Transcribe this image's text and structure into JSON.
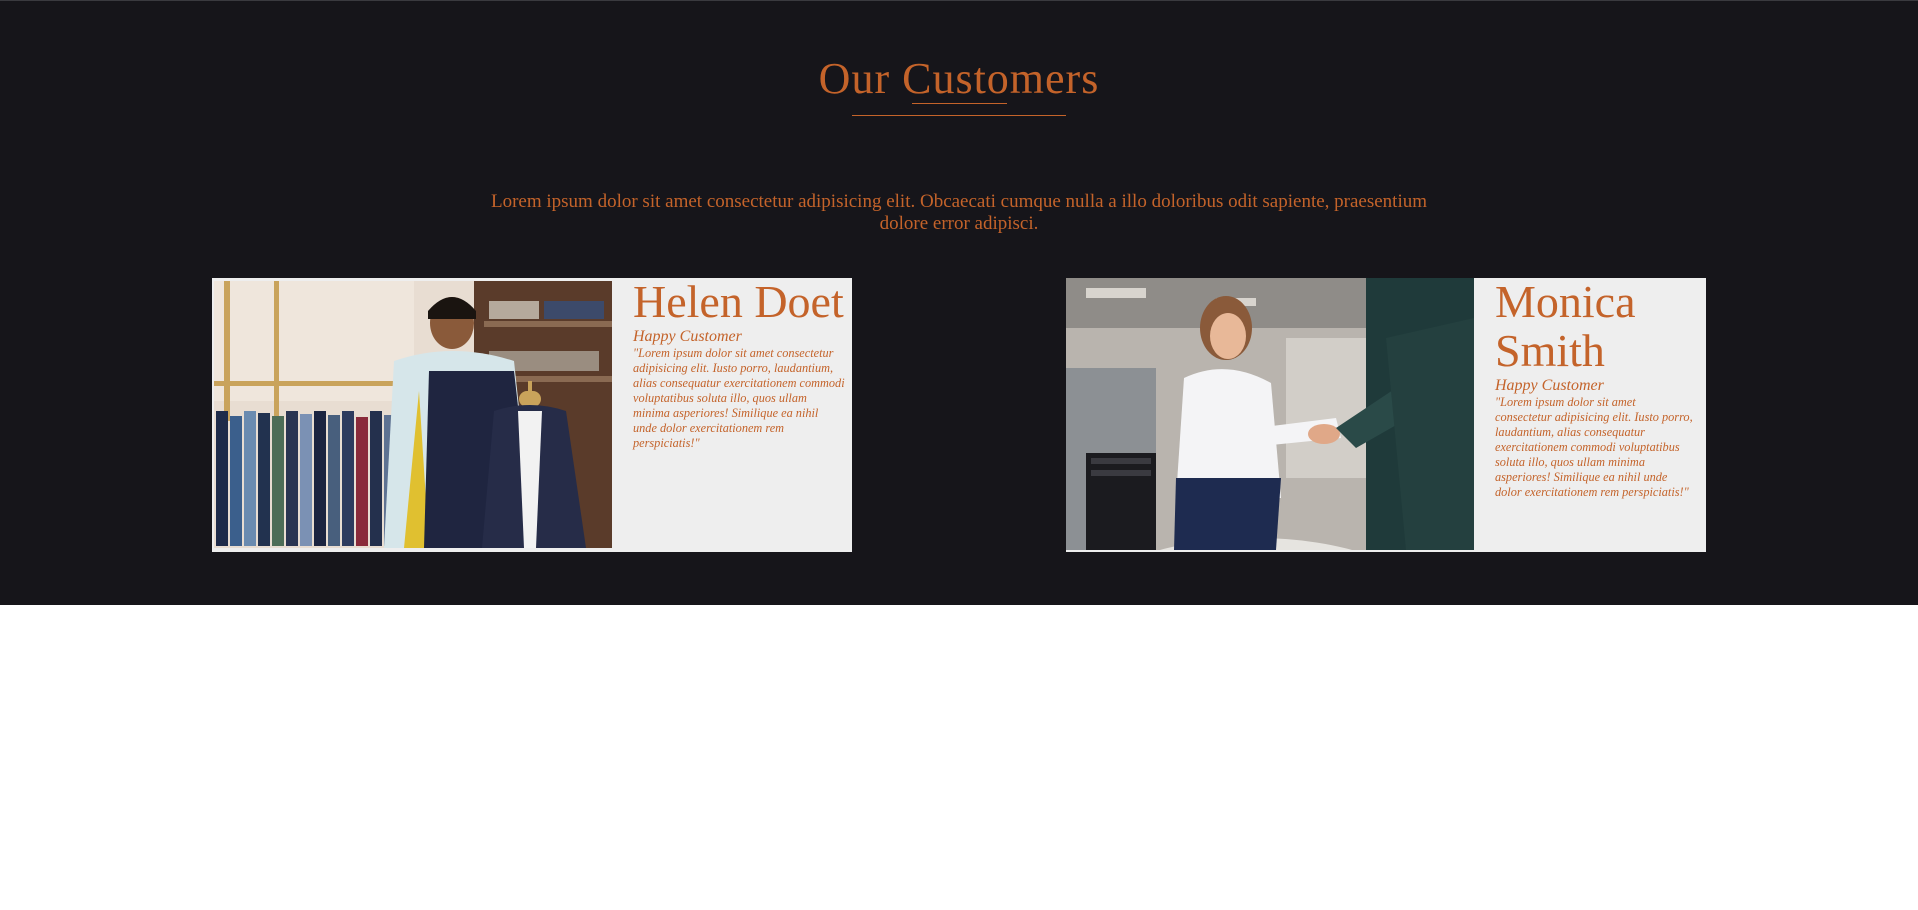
{
  "section": {
    "title": "Our Customers",
    "intro": "Lorem ipsum dolor sit amet consectetur adipisicing elit. Obcaecati cumque nulla a illo doloribus odit sapiente, praesentium dolore error adipisci."
  },
  "customers": [
    {
      "name": "Helen Doet",
      "role": "Happy Customer",
      "quote": "\"Lorem ipsum dolor sit amet consectetur adipisicing elit. Iusto porro, laudantium, alias consequatur exercitationem commodi voluptatibus soluta illo, quos ullam minima asperiores! Similique ea nihil unde dolor exercitationem rem perspiciatis!\"",
      "photo_icon": "tailor-photo"
    },
    {
      "name": "Monica Smith",
      "role": "Happy Customer",
      "quote": "\"Lorem ipsum dolor sit amet consectetur adipisicing elit. Iusto porro, laudantium, alias consequatur exercitationem commodi voluptatibus soluta illo, quos ullam minima asperiores! Similique ea nihil unde dolor exercitationem rem perspiciatis!\"",
      "photo_icon": "handshake-photo"
    }
  ],
  "colors": {
    "background": "#16151a",
    "accent": "#c4632a",
    "card": "#eeeeee"
  }
}
